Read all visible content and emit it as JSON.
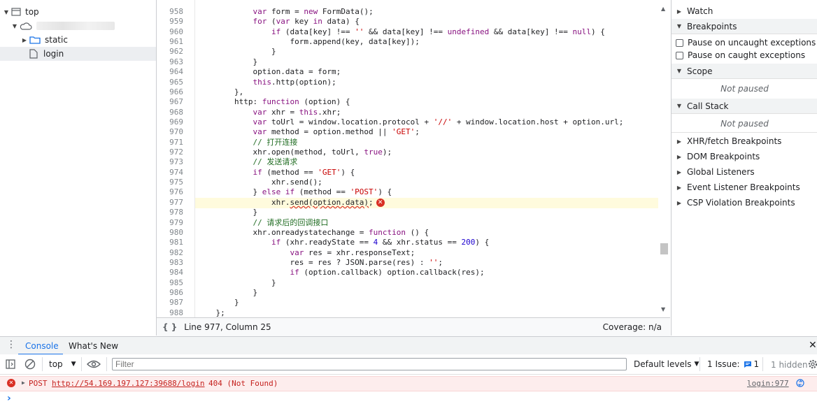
{
  "navigator": {
    "items": [
      {
        "label": "top",
        "icon": "frame-icon"
      },
      {
        "label": "",
        "icon": "cloud-icon"
      },
      {
        "label": "static",
        "icon": "folder-icon"
      },
      {
        "label": "login",
        "icon": "file-icon"
      }
    ]
  },
  "editor": {
    "lines": [
      {
        "n": "958",
        "html": "            <span class=\"kw\">var</span> form = <span class=\"kw\">new</span> FormData();"
      },
      {
        "n": "959",
        "html": "            <span class=\"kw\">for</span> (<span class=\"kw\">var</span> key <span class=\"kw\">in</span> data) {"
      },
      {
        "n": "960",
        "html": "                <span class=\"kw\">if</span> (data[key] !== <span class=\"str\">''</span> &amp;&amp; data[key] !== <span class=\"kw\">undefined</span> &amp;&amp; data[key] !== <span class=\"kw\">null</span>) {"
      },
      {
        "n": "961",
        "html": "                    form.append(key, data[key]);"
      },
      {
        "n": "962",
        "html": "                }"
      },
      {
        "n": "963",
        "html": "            }"
      },
      {
        "n": "964",
        "html": "            option.data = form;"
      },
      {
        "n": "965",
        "html": "            <span class=\"kw\">this</span>.http(option);"
      },
      {
        "n": "966",
        "html": "        },"
      },
      {
        "n": "967",
        "html": "        http: <span class=\"kw\">function</span> (option) {"
      },
      {
        "n": "968",
        "html": "            <span class=\"kw\">var</span> xhr = <span class=\"kw\">this</span>.xhr;"
      },
      {
        "n": "969",
        "html": "            <span class=\"kw\">var</span> toUrl = window.location.protocol + <span class=\"str\">'//'</span> + window.location.host + option.url;"
      },
      {
        "n": "970",
        "html": "            <span class=\"kw\">var</span> method = option.method || <span class=\"str\">'GET'</span>;"
      },
      {
        "n": "971",
        "html": "            <span class=\"cm\">// 打开连接</span>"
      },
      {
        "n": "972",
        "html": "            xhr.open(method, toUrl, <span class=\"kw\">true</span>);"
      },
      {
        "n": "973",
        "html": "            <span class=\"cm\">// 发送请求</span>"
      },
      {
        "n": "974",
        "html": "            <span class=\"kw\">if</span> (method == <span class=\"str\">'GET'</span>) {"
      },
      {
        "n": "975",
        "html": "                xhr.send();"
      },
      {
        "n": "976",
        "html": "            } <span class=\"kw\">else if</span> (method == <span class=\"str\">'POST'</span>) {"
      },
      {
        "n": "977",
        "html": "                xhr.<span class=\"squig\">send(option.data)</span>;<span class=\"err-icon\">✕</span>"
      },
      {
        "n": "978",
        "html": "            }"
      },
      {
        "n": "979",
        "html": "            <span class=\"cm\">// 请求后的回调接口</span>"
      },
      {
        "n": "980",
        "html": "            xhr.onreadystatechange = <span class=\"kw\">function</span> () {"
      },
      {
        "n": "981",
        "html": "                <span class=\"kw\">if</span> (xhr.readyState == <span class=\"num\">4</span> &amp;&amp; xhr.status == <span class=\"num\">200</span>) {"
      },
      {
        "n": "982",
        "html": "                    <span class=\"kw\">var</span> res = xhr.responseText;"
      },
      {
        "n": "983",
        "html": "                    res = res ? JSON.parse(res) : <span class=\"str\">''</span>;"
      },
      {
        "n": "984",
        "html": "                    <span class=\"kw\">if</span> (option.callback) option.callback(res);"
      },
      {
        "n": "985",
        "html": "                }"
      },
      {
        "n": "986",
        "html": "            }"
      },
      {
        "n": "987",
        "html": "        }"
      },
      {
        "n": "988",
        "html": "    };"
      }
    ],
    "status": {
      "position": "Line 977, Column 25",
      "coverage": "Coverage: n/a",
      "braces_icon": "{ }"
    }
  },
  "sidebar": {
    "watch": "Watch",
    "breakpoints": "Breakpoints",
    "pause_uncaught": "Pause on uncaught exceptions",
    "pause_caught": "Pause on caught exceptions",
    "scope": "Scope",
    "not_paused": "Not paused",
    "call_stack": "Call Stack",
    "not_paused_2": "Not paused",
    "sections": [
      "XHR/fetch Breakpoints",
      "DOM Breakpoints",
      "Global Listeners",
      "Event Listener Breakpoints",
      "CSP Violation Breakpoints"
    ]
  },
  "drawer": {
    "tabs": [
      "Console",
      "What's New"
    ],
    "context": "top",
    "filter_placeholder": "Filter",
    "levels": "Default levels",
    "issues_label": "1 Issue:",
    "issues_count": "1",
    "hidden": "1 hidden"
  },
  "console": {
    "method": "POST",
    "url": "http://54.169.197.127:39688/login",
    "status": "404 (Not Found)",
    "source": "login:977",
    "prompt": "›"
  }
}
